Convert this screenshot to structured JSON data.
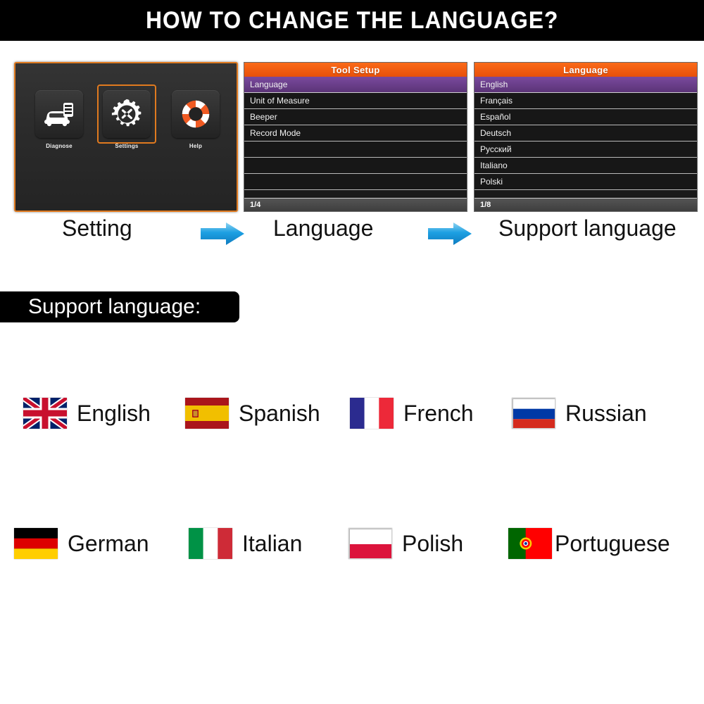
{
  "header": {
    "title": "HOW TO CHANGE THE LANGUAGE?"
  },
  "colors": {
    "banner_bg": "#000000",
    "accent_orange": "#f2590f",
    "selection_purple": "#6b3f8c",
    "arrow_blue": "#1a9ee0",
    "screen_bg": "#1a1a1a"
  },
  "home_screen": {
    "tiles": [
      {
        "label": "Diagnose",
        "icon": "car-scanner-icon",
        "selected": false
      },
      {
        "label": "Settings",
        "icon": "gear-tools-icon",
        "selected": true
      },
      {
        "label": "Help",
        "icon": "life-ring-icon",
        "selected": false
      }
    ]
  },
  "tool_setup_screen": {
    "header": "Tool Setup",
    "rows": [
      {
        "label": "Language",
        "selected": true
      },
      {
        "label": "Unit of Measure",
        "selected": false
      },
      {
        "label": "Beeper",
        "selected": false
      },
      {
        "label": "Record Mode",
        "selected": false
      },
      {
        "label": "",
        "selected": false
      },
      {
        "label": "",
        "selected": false
      },
      {
        "label": "",
        "selected": false
      }
    ],
    "footer": "1/4"
  },
  "language_screen": {
    "header": "Language",
    "rows": [
      {
        "label": "English",
        "selected": true
      },
      {
        "label": "Français",
        "selected": false
      },
      {
        "label": "Español",
        "selected": false
      },
      {
        "label": "Deutsch",
        "selected": false
      },
      {
        "label": "Русский",
        "selected": false
      },
      {
        "label": "Italiano",
        "selected": false
      },
      {
        "label": "Polski",
        "selected": false
      }
    ],
    "footer": "1/8"
  },
  "flow": {
    "steps": [
      {
        "label": "Setting"
      },
      {
        "label": "Language"
      },
      {
        "label": "Support language"
      }
    ],
    "arrow_icon": "right-arrow-icon"
  },
  "support_section": {
    "banner": "Support language:",
    "languages": [
      {
        "name": "English",
        "flag": "flag-uk"
      },
      {
        "name": "Spanish",
        "flag": "flag-spain"
      },
      {
        "name": "French",
        "flag": "flag-france"
      },
      {
        "name": "Russian",
        "flag": "flag-russia"
      },
      {
        "name": "German",
        "flag": "flag-germany"
      },
      {
        "name": "Italian",
        "flag": "flag-italy"
      },
      {
        "name": "Polish",
        "flag": "flag-poland"
      },
      {
        "name": "Portuguese",
        "flag": "flag-portugal"
      }
    ]
  }
}
